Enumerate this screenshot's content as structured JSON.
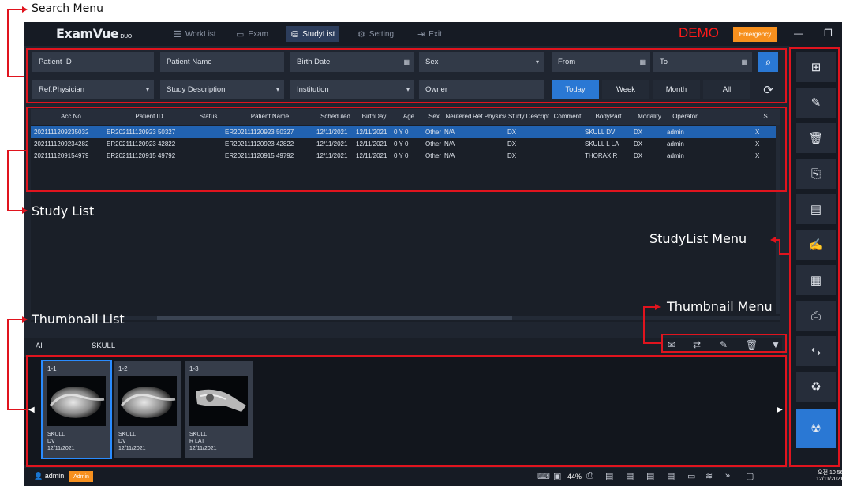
{
  "annotations": {
    "search_menu": "Search Menu",
    "study_list": "Study List",
    "studylist_menu": "StudyList Menu",
    "thumbnail_menu": "Thumbnail Menu",
    "thumbnail_list": "Thumbnail List"
  },
  "app": {
    "logo_main": "ExamVue",
    "logo_sub": "DUO",
    "nav": [
      "WorkList",
      "Exam",
      "StudyList",
      "Setting",
      "Exit"
    ],
    "demo_label": "DEMO",
    "emergency_label": "Emergency"
  },
  "search": {
    "row1": [
      "Patient ID",
      "Patient Name",
      "Birth Date",
      "Sex",
      "From",
      "To"
    ],
    "row2": [
      "Ref.Physician",
      "Study Description",
      "Institution",
      "Owner"
    ],
    "periods": [
      "Today",
      "Week",
      "Month",
      "All"
    ]
  },
  "table": {
    "columns": [
      "Acc.No.",
      "Patient ID",
      "Status",
      "Patient Name",
      "Scheduled",
      "BirthDay",
      "Age",
      "Sex",
      "Neutered",
      "Ref.Physicia",
      "Study Descript",
      "Comment",
      "BodyPart",
      "Modality",
      "Operator",
      "S"
    ],
    "rows": [
      [
        "2021111209235032",
        "ER202111120923 50327",
        "",
        "ER202111120923 50327",
        "12/11/2021",
        "12/11/2021",
        "0 Y 0",
        "Other",
        "N/A",
        "",
        "DX",
        "",
        "SKULL DV",
        "DX",
        "admin",
        "X"
      ],
      [
        "2021111209234282",
        "ER202111120923 42822",
        "",
        "ER202111120923 42822",
        "12/11/2021",
        "12/11/2021",
        "0 Y 0",
        "Other",
        "N/A",
        "",
        "DX",
        "",
        "SKULL L LA",
        "DX",
        "admin",
        "X"
      ],
      [
        "2021111209154979",
        "ER202111120915 49792",
        "",
        "ER202111120915 49792",
        "12/11/2021",
        "12/11/2021",
        "0 Y 0",
        "Other",
        "N/A",
        "",
        "DX",
        "",
        "THORAX R",
        "DX",
        "admin",
        "X"
      ]
    ]
  },
  "thumb_tabs": [
    "All",
    "SKULL"
  ],
  "thumbnails": [
    {
      "num": "1-1",
      "line1": "SKULL",
      "line2": "DV",
      "date": "12/11/2021"
    },
    {
      "num": "1-2",
      "line1": "SKULL",
      "line2": "DV",
      "date": "12/11/2021"
    },
    {
      "num": "1-3",
      "line1": "SKULL",
      "line2": "R LAT",
      "date": "12/11/2021"
    }
  ],
  "status": {
    "user": "admin",
    "role": "Admin",
    "battery": "44%",
    "clock_time": "오전 10:56",
    "clock_date": "12/11/2021"
  },
  "right_menu_icons": [
    "import-icon",
    "edit-icon",
    "delete-icon",
    "export-icon",
    "report-icon",
    "edit-report-icon",
    "compare-icon",
    "dicom-print-icon",
    "transfer-icon",
    "recycle-icon",
    "radiation-icon"
  ]
}
